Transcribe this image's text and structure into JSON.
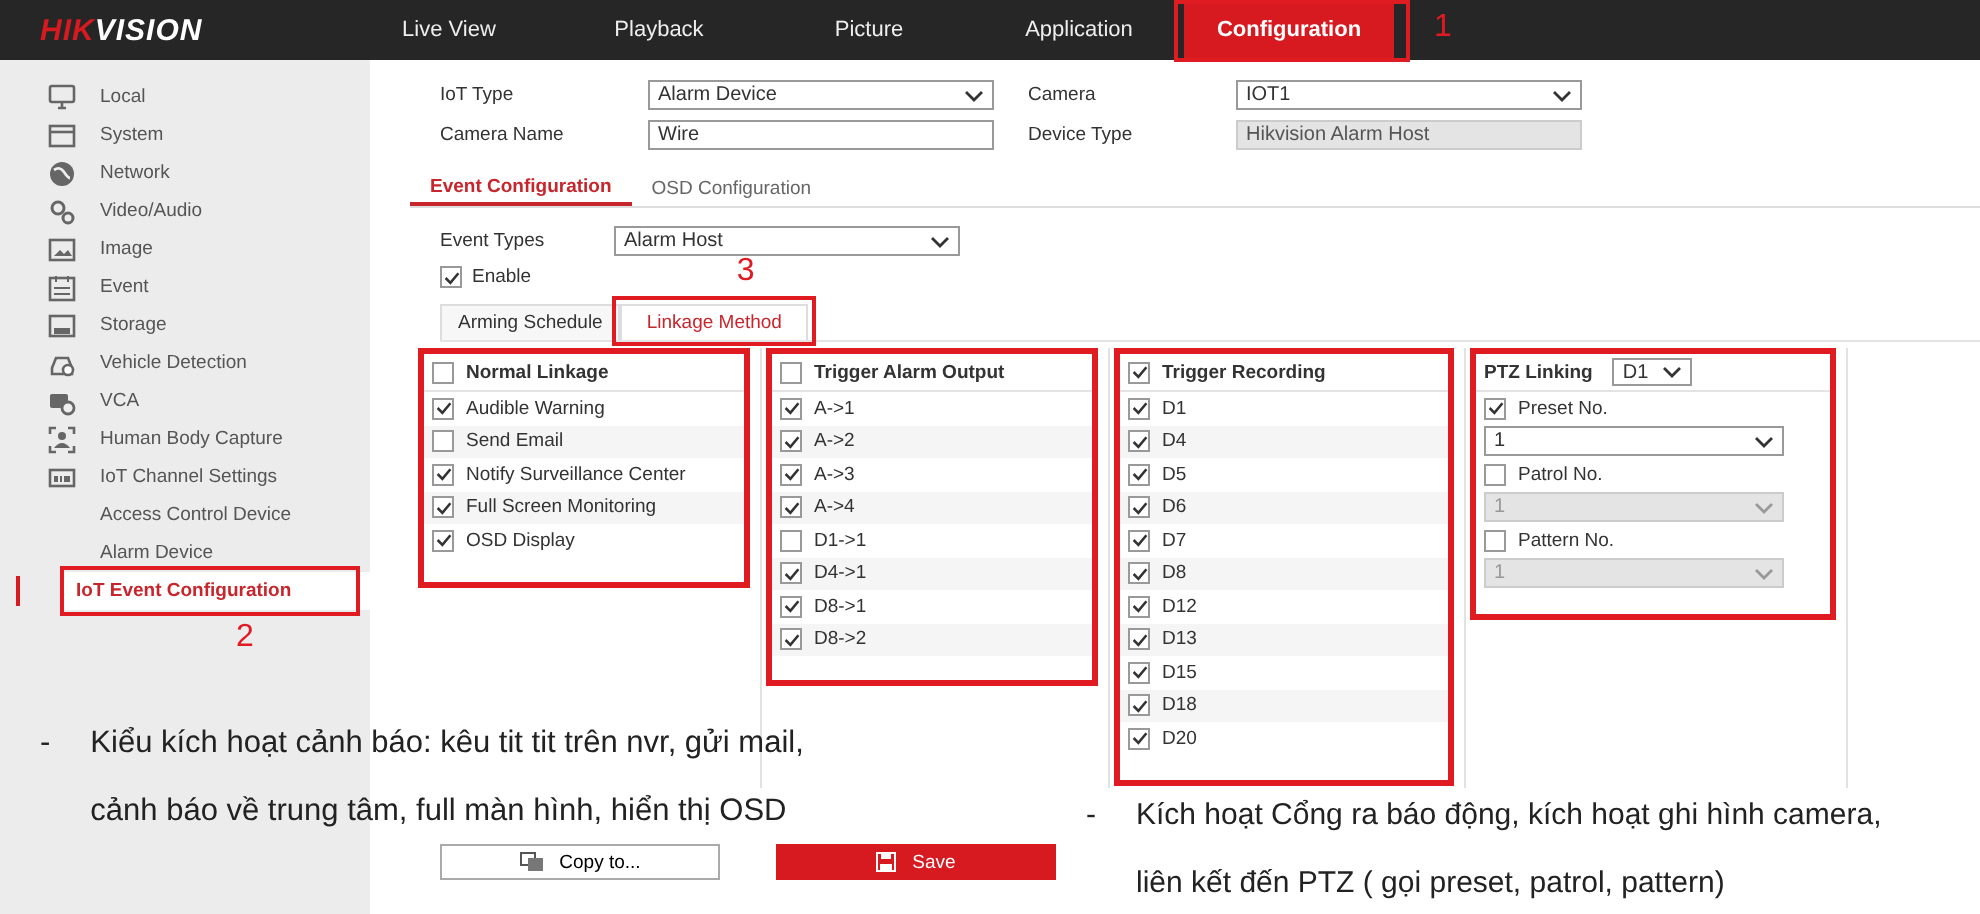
{
  "header": {
    "logo": {
      "accent": "HIK",
      "rest": "VISION"
    },
    "tabs": [
      {
        "label": "Live View",
        "selected": false
      },
      {
        "label": "Playback",
        "selected": false
      },
      {
        "label": "Picture",
        "selected": false
      },
      {
        "label": "Application",
        "selected": false
      },
      {
        "label": "Configuration",
        "selected": true,
        "callout": "1"
      }
    ]
  },
  "sidebar": {
    "items": [
      {
        "label": "Local",
        "selected": false
      },
      {
        "label": "System",
        "selected": false
      },
      {
        "label": "Network",
        "selected": false
      },
      {
        "label": "Video/Audio",
        "selected": false
      },
      {
        "label": "Image",
        "selected": false
      },
      {
        "label": "Event",
        "selected": false
      },
      {
        "label": "Storage",
        "selected": false
      },
      {
        "label": "Vehicle Detection",
        "selected": false
      },
      {
        "label": "VCA",
        "selected": false
      },
      {
        "label": "Human Body Capture",
        "selected": false
      },
      {
        "label": "IoT Channel Settings",
        "selected": false,
        "children": [
          {
            "label": "Access Control Device",
            "selected": false
          },
          {
            "label": "Alarm Device",
            "selected": false
          },
          {
            "label": "IoT Event Configuration",
            "selected": true,
            "callout": "2"
          }
        ]
      }
    ]
  },
  "form": {
    "fields": [
      {
        "label": "IoT Type",
        "kind": "select",
        "value": "Alarm Device"
      },
      {
        "label": "Camera",
        "kind": "select",
        "value": "IOT1"
      },
      {
        "label": "Camera Name",
        "kind": "text",
        "value": "Wire"
      },
      {
        "label": "Device Type",
        "kind": "readonly",
        "value": "Hikvision Alarm Host"
      }
    ]
  },
  "sub_tabs": [
    {
      "label": "Event Configuration",
      "selected": true
    },
    {
      "label": "OSD Configuration",
      "selected": false
    }
  ],
  "event_types": {
    "label": "Event Types",
    "value": "Alarm Host"
  },
  "enable": {
    "label": "Enable",
    "checked": true
  },
  "method_tabs": [
    {
      "label": "Arming Schedule",
      "selected": false
    },
    {
      "label": "Linkage Method",
      "selected": true,
      "callout": "3"
    }
  ],
  "panels": [
    {
      "kind": "checklist",
      "title": "Normal Linkage",
      "checked": false,
      "highlighted": true,
      "items": [
        {
          "label": "Audible Warning",
          "checked": true
        },
        {
          "label": "Send Email",
          "checked": false
        },
        {
          "label": "Notify Surveillance Center",
          "checked": true
        },
        {
          "label": "Full Screen Monitoring",
          "checked": true
        },
        {
          "label": "OSD Display",
          "checked": true
        }
      ]
    },
    {
      "kind": "checklist",
      "title": "Trigger Alarm Output",
      "checked": false,
      "highlighted": true,
      "items": [
        {
          "label": "A->1",
          "checked": true
        },
        {
          "label": "A->2",
          "checked": true
        },
        {
          "label": "A->3",
          "checked": true
        },
        {
          "label": "A->4",
          "checked": true
        },
        {
          "label": "D1->1",
          "checked": false
        },
        {
          "label": "D4->1",
          "checked": true
        },
        {
          "label": "D8->1",
          "checked": true
        },
        {
          "label": "D8->2",
          "checked": true
        }
      ]
    },
    {
      "kind": "checklist",
      "title": "Trigger Recording",
      "checked": true,
      "highlighted": true,
      "items": [
        {
          "label": "D1",
          "checked": true
        },
        {
          "label": "D4",
          "checked": true
        },
        {
          "label": "D5",
          "checked": true
        },
        {
          "label": "D6",
          "checked": true
        },
        {
          "label": "D7",
          "checked": true
        },
        {
          "label": "D8",
          "checked": true
        },
        {
          "label": "D12",
          "checked": true
        },
        {
          "label": "D13",
          "checked": true
        },
        {
          "label": "D15",
          "checked": true
        },
        {
          "label": "D18",
          "checked": true
        },
        {
          "label": "D20",
          "checked": true
        }
      ]
    },
    {
      "kind": "ptz",
      "title": "PTZ Linking",
      "channel": "D1",
      "highlighted": true,
      "options": [
        {
          "label": "Preset No.",
          "checked": true,
          "value": "1"
        },
        {
          "label": "Patrol No.",
          "checked": false,
          "value": "1"
        },
        {
          "label": "Pattern No.",
          "checked": false,
          "value": "1"
        }
      ]
    }
  ],
  "buttons": [
    {
      "label": "Copy to...",
      "kind": "secondary"
    },
    {
      "label": "Save",
      "kind": "primary"
    }
  ],
  "notes": [
    {
      "bullet": "-",
      "lines": [
        "Kiểu kích hoạt cảnh báo: kêu tit tit trên nvr, gửi mail,",
        "cảnh báo về trung tâm, full màn hình, hiển thị OSD"
      ]
    },
    {
      "bullet": "-",
      "lines": [
        "Kích hoạt Cổng ra báo động, kích hoạt ghi hình camera,",
        "liên kết đến PTZ ( gọi preset, patrol, pattern)"
      ]
    }
  ]
}
